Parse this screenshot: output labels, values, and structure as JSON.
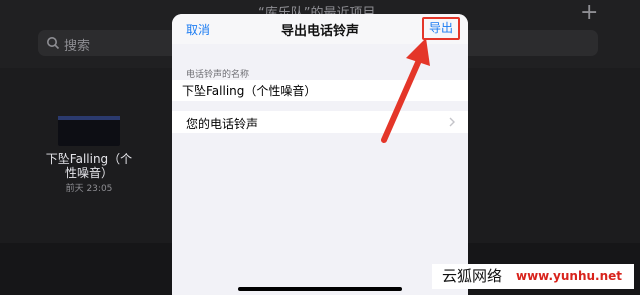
{
  "background": {
    "title": "“库乐队”的最近项目",
    "search_placeholder": "搜索",
    "file": {
      "name": "下坠Falling（个性噪音）",
      "time": "前天 23:05"
    }
  },
  "sheet": {
    "cancel_label": "取消",
    "title": "导出电话铃声",
    "export_label": "导出",
    "name_section_label": "电话铃声的名称",
    "name_value": "下坠Falling（个性噪音）",
    "ringtone_row_label": "您的电话铃声"
  },
  "watermark": {
    "left": "云狐网络",
    "right": "www.yunhu.net"
  },
  "colors": {
    "accent": "#1c7cf2",
    "annotation": "#e43629"
  }
}
